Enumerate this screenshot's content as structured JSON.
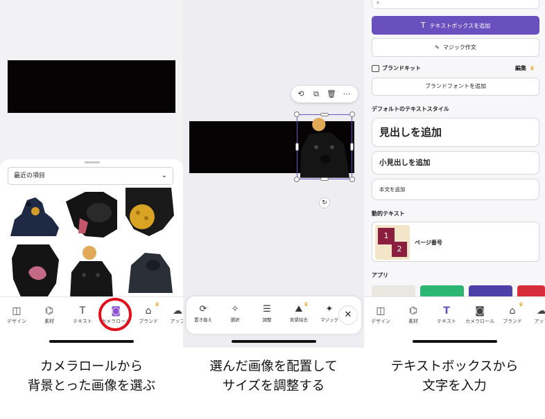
{
  "panel1": {
    "dropdown": "最近の項目",
    "nav": [
      "デザイン",
      "素材",
      "テキスト",
      "カメラロール",
      "ブランド",
      "アップ"
    ]
  },
  "panel2": {
    "tools": [
      "置き換え",
      "選択",
      "調整",
      "背景除去",
      "マジック"
    ]
  },
  "panel3": {
    "add_textbox": "テキストボックスを追加",
    "magic_write": "マジック作文",
    "brand_kit": "ブランドキット",
    "edit": "編集",
    "add_brand_font": "ブランドフォントを追加",
    "default_styles": "デフォルトのテキストスタイル",
    "add_heading": "見出しを追加",
    "add_subheading": "小見出しを追加",
    "add_body": "本文を追加",
    "dynamic_text": "動的テキスト",
    "page_number": "ページ番号",
    "page_thumb_1": "1",
    "page_thumb_2": "2",
    "apps": "アプリ",
    "nav": [
      "デザイン",
      "素材",
      "テキスト",
      "カメラロール",
      "ブランド",
      "アップ"
    ]
  },
  "captions": [
    [
      "カメラロールから",
      "背景とった画像を選ぶ"
    ],
    [
      "選んだ画像を配置して",
      "サイズを調整する"
    ],
    [
      "テキストボックスから",
      "文字を入力"
    ]
  ],
  "colors": {
    "accent": "#6a4fbf",
    "highlight_circle": "#e1101c",
    "crown": "#e3a21a",
    "page_number_badge": "#8b1e3f"
  }
}
